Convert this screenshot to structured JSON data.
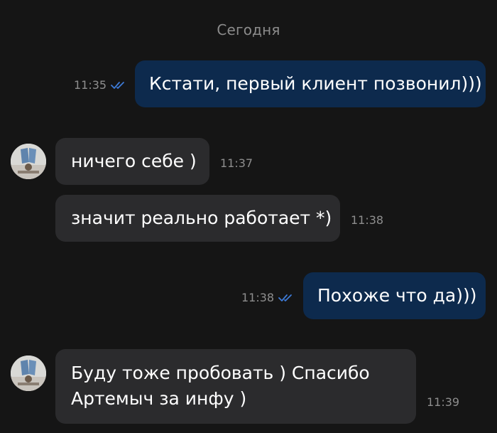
{
  "date_separator": "Сегодня",
  "colors": {
    "background": "#151515",
    "outgoing_bubble": "#0d2a4d",
    "incoming_bubble": "#2b2b2d",
    "timestamp": "#8e8e8e",
    "read_check": "#3d7ad6"
  },
  "messages": [
    {
      "direction": "outgoing",
      "text": "Кстати, первый клиент позвонил)))",
      "time": "11:35",
      "status_icon": "double-check-icon"
    },
    {
      "direction": "incoming",
      "text": "ничего себе )",
      "time": "11:37",
      "avatar": "avatar"
    },
    {
      "direction": "incoming",
      "text": "значит реально работает *)",
      "time": "11:38"
    },
    {
      "direction": "outgoing",
      "text": "Похоже что да)))",
      "time": "11:38",
      "status_icon": "double-check-icon"
    },
    {
      "direction": "incoming",
      "lines": [
        "Буду тоже пробовать )  Спасибо",
        "Артемыч  за инфу )"
      ],
      "time": "11:39",
      "avatar": "avatar"
    }
  ]
}
